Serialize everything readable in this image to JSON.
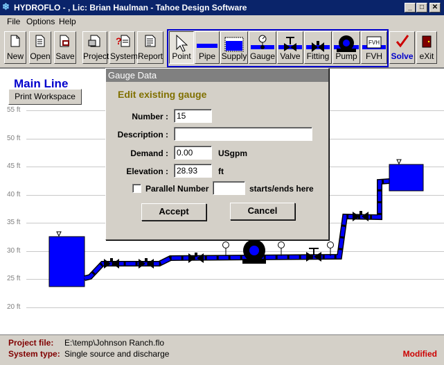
{
  "window": {
    "title": "HYDROFLO - , Lic: Brian Haulman - Tahoe Design Software",
    "min": "_",
    "max": "□",
    "close": "✕"
  },
  "menu": [
    "File",
    "Options",
    "Help"
  ],
  "toolbar": {
    "new": "New",
    "open": "Open",
    "save": "Save",
    "project": "Project",
    "system": "System",
    "report": "Report",
    "point": "Point",
    "pipe": "Pipe",
    "supply": "Supply",
    "gauge": "Gauge",
    "valve": "Valve",
    "fitting": "Fitting",
    "pump": "Pump",
    "fvh": "FVH",
    "fvh_icon_text": "FVH",
    "solve": "Solve",
    "exit": "eXit"
  },
  "workspace": {
    "title": "Main Line",
    "print_button": "Print Workspace",
    "y_ticks": [
      "55 ft",
      "50 ft",
      "45 ft",
      "40 ft",
      "35 ft",
      "30 ft",
      "25 ft",
      "20 ft"
    ]
  },
  "dialog": {
    "title": "Gauge Data",
    "subtitle": "Edit existing gauge",
    "number_label": "Number :",
    "number_value": "15",
    "description_label": "Description :",
    "description_value": "",
    "demand_label": "Demand :",
    "demand_value": "0.00",
    "demand_unit": "USgpm",
    "elevation_label": "Elevation :",
    "elevation_value": "28.93",
    "elevation_unit": "ft",
    "parallel_label": "Parallel Number",
    "parallel_value": "",
    "parallel_suffix": "starts/ends here",
    "parallel_checked": false,
    "accept": "Accept",
    "cancel": "Cancel"
  },
  "status": {
    "project_label": "Project file:",
    "project_value": "E:\\temp\\Johnson Ranch.flo",
    "system_label": "System type:",
    "system_value": "Single source and discharge",
    "modified": "Modified"
  },
  "colors": {
    "titlebar": "#0a246a",
    "pipe": "#0000ff",
    "accent_blue": "#0000cc",
    "dialog_header": "#808080",
    "modified": "#cc0000"
  }
}
